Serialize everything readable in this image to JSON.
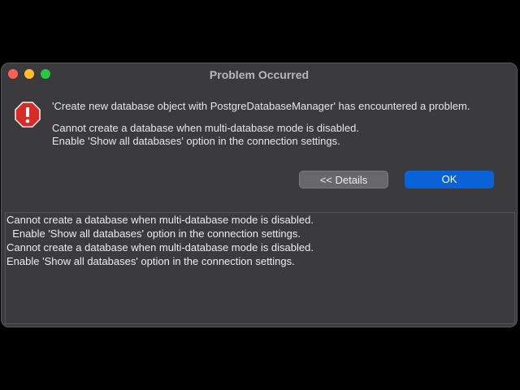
{
  "window": {
    "title": "Problem Occurred"
  },
  "dialog": {
    "icon": "error-icon",
    "header_message": "'Create new database object with PostgreDatabaseManager' has encountered a problem.",
    "detail_lines": [
      "Cannot create a database when multi-database mode is disabled.",
      "Enable 'Show all databases' option in the connection settings."
    ],
    "buttons": {
      "details_label": "<< Details",
      "ok_label": "OK"
    }
  },
  "details": {
    "lines": [
      "Cannot create a database when multi-database mode is disabled.",
      "  Enable 'Show all databases' option in the connection settings.",
      "Cannot create a database when multi-database mode is disabled.",
      "Enable 'Show all databases' option in the connection settings."
    ]
  },
  "colors": {
    "window_bg": "#3b3a3d",
    "accent": "#0a62d9",
    "error": "#e0302b"
  }
}
